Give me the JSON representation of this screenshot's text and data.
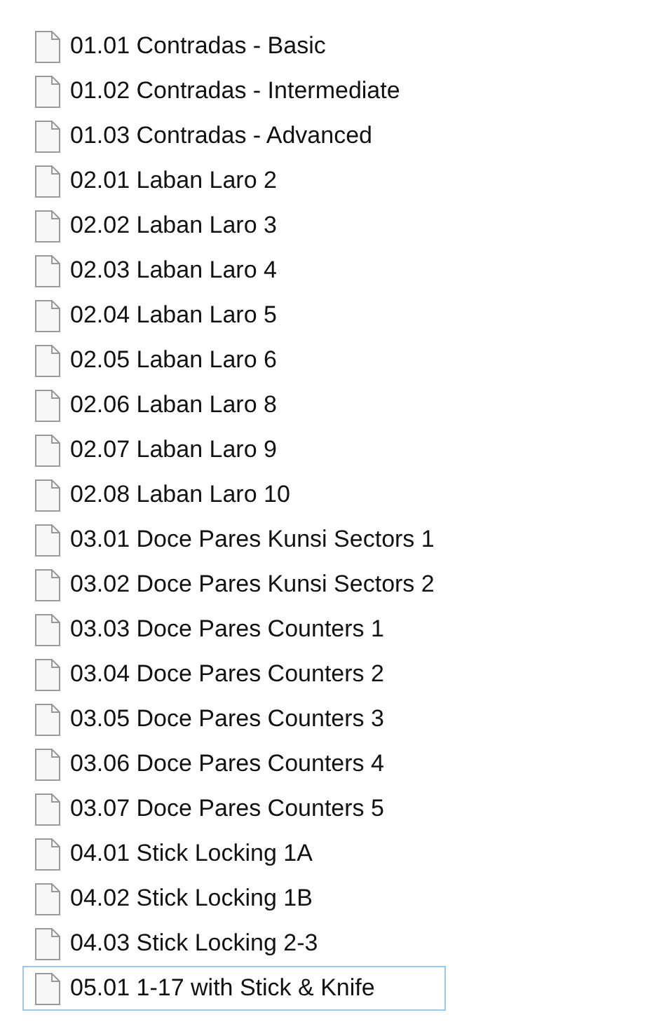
{
  "files": [
    {
      "name": "01.01 Contradas - Basic",
      "focused": false
    },
    {
      "name": "01.02 Contradas - Intermediate",
      "focused": false
    },
    {
      "name": "01.03 Contradas - Advanced",
      "focused": false
    },
    {
      "name": "02.01 Laban Laro 2",
      "focused": false
    },
    {
      "name": "02.02 Laban Laro 3",
      "focused": false
    },
    {
      "name": "02.03 Laban Laro 4",
      "focused": false
    },
    {
      "name": "02.04 Laban Laro 5",
      "focused": false
    },
    {
      "name": "02.05 Laban Laro 6",
      "focused": false
    },
    {
      "name": "02.06 Laban Laro 8",
      "focused": false
    },
    {
      "name": "02.07 Laban Laro 9",
      "focused": false
    },
    {
      "name": "02.08 Laban Laro 10",
      "focused": false
    },
    {
      "name": "03.01 Doce Pares Kunsi Sectors 1",
      "focused": false
    },
    {
      "name": "03.02 Doce Pares Kunsi Sectors 2",
      "focused": false
    },
    {
      "name": "03.03 Doce Pares Counters 1",
      "focused": false
    },
    {
      "name": "03.04 Doce Pares Counters 2",
      "focused": false
    },
    {
      "name": "03.05 Doce Pares Counters 3",
      "focused": false
    },
    {
      "name": "03.06 Doce Pares Counters 4",
      "focused": false
    },
    {
      "name": "03.07 Doce Pares Counters 5",
      "focused": false
    },
    {
      "name": "04.01 Stick Locking 1A",
      "focused": false
    },
    {
      "name": "04.02 Stick Locking 1B",
      "focused": false
    },
    {
      "name": "04.03 Stick Locking 2-3",
      "focused": false
    },
    {
      "name": "05.01 1-17 with Stick & Knife",
      "focused": true
    }
  ]
}
